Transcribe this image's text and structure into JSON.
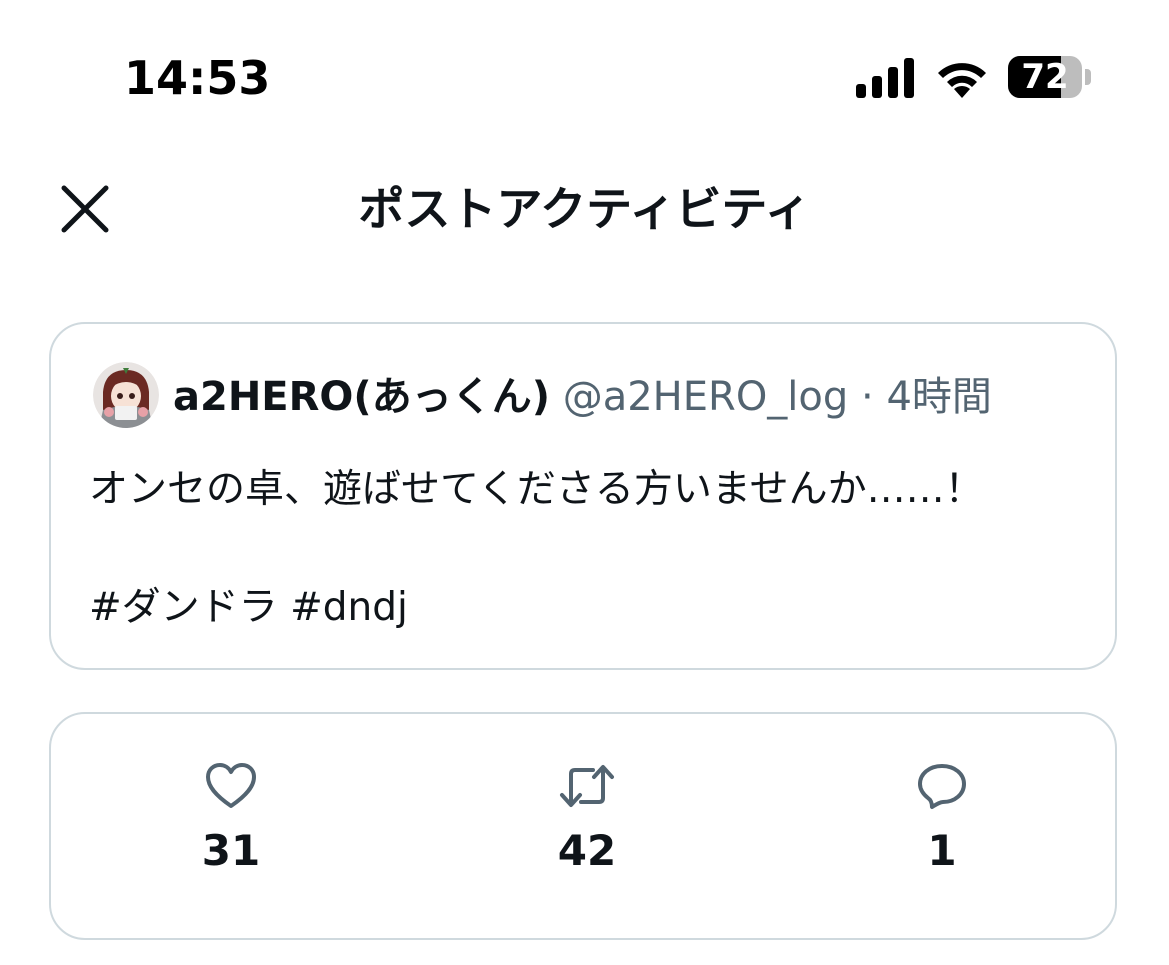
{
  "status_bar": {
    "time": "14:53",
    "battery_level": "72",
    "battery_fraction": 0.72,
    "signal_icon": "cellular-signal-icon",
    "wifi_icon": "wifi-icon"
  },
  "header": {
    "title": "ポストアクティビティ",
    "close_icon": "close-icon"
  },
  "post": {
    "author_name": "a2HERO(あっくん)",
    "handle": "@a2HERO_log",
    "separator": "·",
    "time": "4時間",
    "text": "オンセの卓、遊ばせてくださる方いませんか……！",
    "tags": "#ダンドラ #dndj"
  },
  "stats": {
    "likes": {
      "icon": "heart-icon",
      "value": "31"
    },
    "reposts": {
      "icon": "repost-icon",
      "value": "42"
    },
    "replies": {
      "icon": "reply-icon",
      "value": "1"
    }
  },
  "colors": {
    "text_primary": "#0f1419",
    "text_secondary": "#536471",
    "border": "#cfd9de",
    "icon": "#536471"
  }
}
